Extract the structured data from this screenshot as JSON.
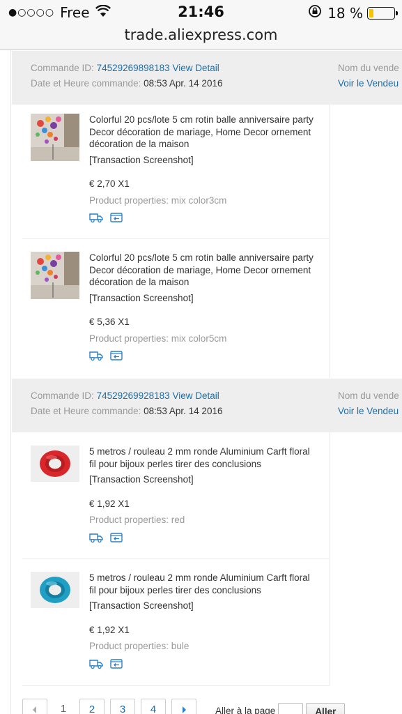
{
  "status_bar": {
    "carrier": "Free",
    "time": "21:46",
    "battery": "18 %",
    "battery_level": 0.18
  },
  "url_bar": {
    "domain": "trade.aliexpress.com"
  },
  "orders": [
    {
      "id_label": "Commande ID:",
      "id_value": "74529269898183",
      "view_detail": "View Detail",
      "date_label": "Date et Heure commande:",
      "date_value": "08:53 Apr. 14 2016",
      "seller_label": "Nom du vende",
      "seller_link": "Voir le Vendeu",
      "products": [
        {
          "title": "Colorful 20 pcs/lote 5 cm rotin balle anniversaire party Decor décoration de mariage, Home Decor ornement décoration de la maison",
          "screenshot_link": "[Transaction Screenshot]",
          "price": "€ 2,70 X1",
          "properties": "Product properties: mix color3cm",
          "image": "colorful-balls"
        },
        {
          "title": "Colorful 20 pcs/lote 5 cm rotin balle anniversaire party Decor décoration de mariage, Home Decor ornement décoration de la maison",
          "screenshot_link": "[Transaction Screenshot]",
          "price": "€ 5,36 X1",
          "properties": "Product properties: mix color5cm",
          "image": "colorful-balls"
        }
      ]
    },
    {
      "id_label": "Commande ID:",
      "id_value": "74529269928183",
      "view_detail": "View Detail",
      "date_label": "Date et Heure commande:",
      "date_value": "08:53 Apr. 14 2016",
      "seller_label": "Nom du vende",
      "seller_link": "Voir le Vendeu",
      "products": [
        {
          "title": "5 metros / rouleau 2 mm ronde Aluminium Carft floral fil pour bijoux perles tirer des conclusions",
          "screenshot_link": "[Transaction Screenshot]",
          "price": "€ 1,92 X1",
          "properties": "Product properties: red",
          "image": "red-wire",
          "wire_color": "#d8262a"
        },
        {
          "title": "5 metros / rouleau 2 mm ronde Aluminium Carft floral fil pour bijoux perles tirer des conclusions",
          "screenshot_link": "[Transaction Screenshot]",
          "price": "€ 1,92 X1",
          "properties": "Product properties: bule",
          "image": "blue-wire",
          "wire_color": "#1f9fc4"
        }
      ]
    }
  ],
  "pagination": {
    "pages": [
      "1",
      "2",
      "3",
      "4"
    ],
    "current": "1",
    "goto_label": "Aller à la page",
    "goto_button": "Aller"
  },
  "colors": {
    "link": "#1a6ea8",
    "header_bg": "#eeeeee",
    "muted": "#999999",
    "battery": "#f5c400"
  }
}
